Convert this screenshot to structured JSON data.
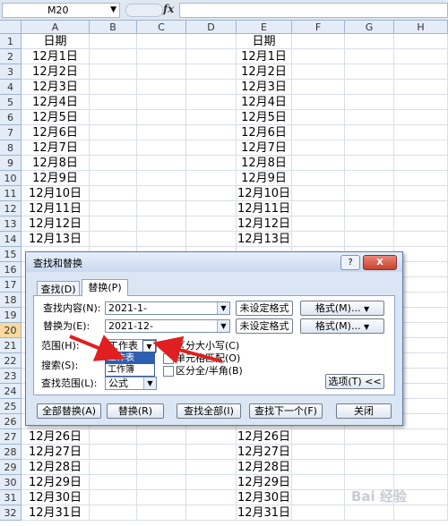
{
  "formula_bar": {
    "name_box": "M20",
    "fx_label": "fx",
    "formula_value": ""
  },
  "columns": [
    "A",
    "B",
    "C",
    "D",
    "E",
    "F",
    "G",
    "H"
  ],
  "selected_row": 20,
  "rows": [
    {
      "n": 1,
      "a": "日期",
      "e": "日期"
    },
    {
      "n": 2,
      "a": "12月1日",
      "e": "12月1日"
    },
    {
      "n": 3,
      "a": "12月2日",
      "e": "12月2日"
    },
    {
      "n": 4,
      "a": "12月3日",
      "e": "12月3日"
    },
    {
      "n": 5,
      "a": "12月4日",
      "e": "12月4日"
    },
    {
      "n": 6,
      "a": "12月5日",
      "e": "12月5日"
    },
    {
      "n": 7,
      "a": "12月6日",
      "e": "12月6日"
    },
    {
      "n": 8,
      "a": "12月7日",
      "e": "12月7日"
    },
    {
      "n": 9,
      "a": "12月8日",
      "e": "12月8日"
    },
    {
      "n": 10,
      "a": "12月9日",
      "e": "12月9日"
    },
    {
      "n": 11,
      "a": "12月10日",
      "e": "12月10日"
    },
    {
      "n": 12,
      "a": "12月11日",
      "e": "12月11日"
    },
    {
      "n": 13,
      "a": "12月12日",
      "e": "12月12日"
    },
    {
      "n": 14,
      "a": "12月13日",
      "e": "12月13日"
    },
    {
      "n": 15,
      "a": "",
      "e": ""
    },
    {
      "n": 16,
      "a": "",
      "e": ""
    },
    {
      "n": 17,
      "a": "",
      "e": ""
    },
    {
      "n": 18,
      "a": "",
      "e": ""
    },
    {
      "n": 19,
      "a": "",
      "e": ""
    },
    {
      "n": 20,
      "a": "",
      "e": ""
    },
    {
      "n": 21,
      "a": "",
      "e": ""
    },
    {
      "n": 22,
      "a": "",
      "e": ""
    },
    {
      "n": 23,
      "a": "",
      "e": ""
    },
    {
      "n": 24,
      "a": "",
      "e": ""
    },
    {
      "n": 25,
      "a": "",
      "e": ""
    },
    {
      "n": 26,
      "a": "",
      "e": ""
    },
    {
      "n": 27,
      "a": "12月26日",
      "e": "12月26日"
    },
    {
      "n": 28,
      "a": "12月27日",
      "e": "12月27日"
    },
    {
      "n": 29,
      "a": "12月28日",
      "e": "12月28日"
    },
    {
      "n": 30,
      "a": "12月29日",
      "e": "12月29日"
    },
    {
      "n": 31,
      "a": "12月30日",
      "e": "12月30日"
    },
    {
      "n": 32,
      "a": "12月31日",
      "e": "12月31日"
    }
  ],
  "dialog": {
    "title": "查找和替换",
    "help_glyph": "?",
    "close_glyph": "X",
    "tab_find": "查找(D)",
    "tab_replace": "替换(P)",
    "find_what_label": "查找内容(N):",
    "find_what_value": "2021-1-",
    "find_format_status": "未设定格式",
    "replace_with_label": "替换为(E):",
    "replace_with_value": "2021-12-",
    "replace_format_status": "未设定格式",
    "format_button": "格式(M)...",
    "format_button2": "格式(M)...",
    "within_label": "范围(H):",
    "within_value": "工作表",
    "within_options": [
      "工作表",
      "工作簿"
    ],
    "search_label": "搜索(S):",
    "look_in_label": "查找范围(L):",
    "look_in_value": "公式",
    "match_case": "区分大小写(C)",
    "match_entire": "单元格匹配(O)",
    "match_byte": "区分全/半角(B)",
    "options_button": "选项(T) <<",
    "replace_all_button": "全部替换(A)",
    "replace_button": "替换(R)",
    "find_all_button": "查找全部(I)",
    "find_next_button": "查找下一个(F)",
    "close_button": "关闭"
  },
  "arrow_color": "#e02020",
  "watermark": "Bai 经验"
}
